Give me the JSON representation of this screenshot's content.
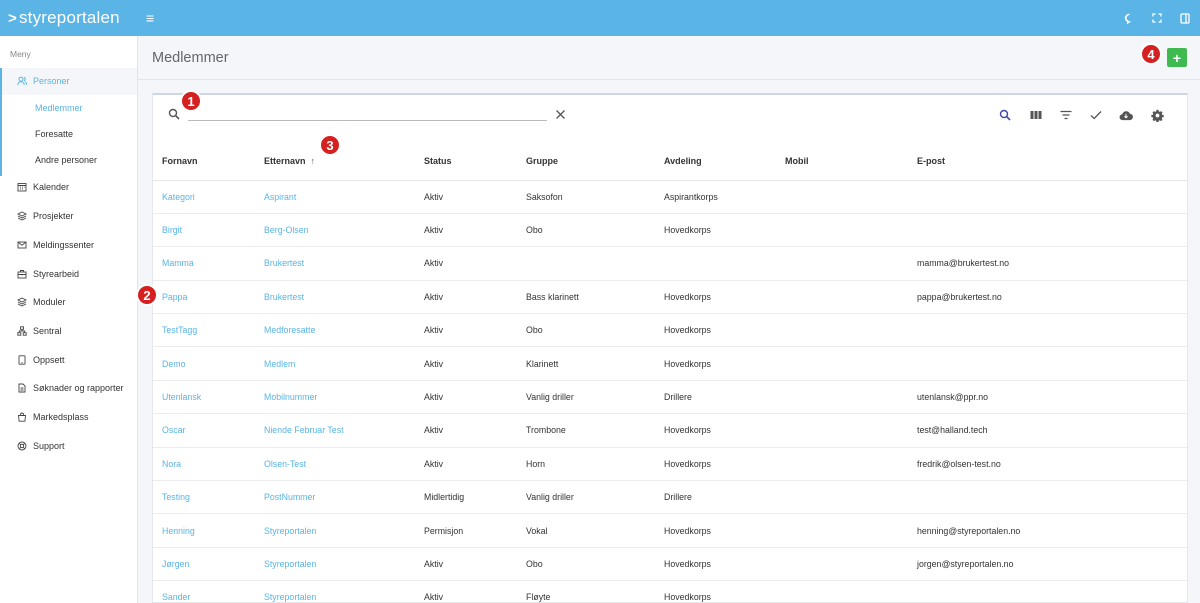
{
  "app": {
    "logo_mark": ">",
    "logo_text": "styreportalen"
  },
  "sidebar": {
    "menu_label": "Meny",
    "group": {
      "label": "Personer",
      "children": [
        {
          "label": "Medlemmer",
          "active": true
        },
        {
          "label": "Foresatte",
          "active": false
        },
        {
          "label": "Andre personer",
          "active": false
        }
      ]
    },
    "items": [
      {
        "label": "Kalender",
        "icon": "calendar-icon"
      },
      {
        "label": "Prosjekter",
        "icon": "layers-icon"
      },
      {
        "label": "Meldingssenter",
        "icon": "mail-icon"
      },
      {
        "label": "Styrearbeid",
        "icon": "briefcase-icon"
      },
      {
        "label": "Moduler",
        "icon": "layers-icon"
      },
      {
        "label": "Sentral",
        "icon": "sitemap-icon"
      },
      {
        "label": "Oppsett",
        "icon": "tablet-icon"
      },
      {
        "label": "Søknader og rapporter",
        "icon": "document-icon"
      },
      {
        "label": "Markedsplass",
        "icon": "shopping-bag-icon"
      },
      {
        "label": "Support",
        "icon": "lifebuoy-icon"
      }
    ]
  },
  "page": {
    "title": "Medlemmer",
    "add_label": "+"
  },
  "badges": [
    "1",
    "2",
    "3",
    "4"
  ],
  "search": {
    "value": "",
    "placeholder": ""
  },
  "table": {
    "columns": [
      "Fornavn",
      "Etternavn",
      "Status",
      "Gruppe",
      "Avdeling",
      "Mobil",
      "E-post"
    ],
    "sort_column": "Etternavn",
    "sort_arrow": "↑",
    "rows": [
      {
        "fornavn": "Kategori",
        "etternavn": "Aspirant",
        "status": "Aktiv",
        "gruppe": "Saksofon",
        "avdeling": "Aspirantkorps",
        "mobil": "",
        "epost": ""
      },
      {
        "fornavn": "Birgit",
        "etternavn": "Berg-Olsen",
        "status": "Aktiv",
        "gruppe": "Obo",
        "avdeling": "Hovedkorps",
        "mobil": "",
        "epost": ""
      },
      {
        "fornavn": "Mamma",
        "etternavn": "Brukertest",
        "status": "Aktiv",
        "gruppe": "",
        "avdeling": "",
        "mobil": "",
        "epost": "mamma@brukertest.no"
      },
      {
        "fornavn": "Pappa",
        "etternavn": "Brukertest",
        "status": "Aktiv",
        "gruppe": "Bass klarinett",
        "avdeling": "Hovedkorps",
        "mobil": "",
        "epost": "pappa@brukertest.no"
      },
      {
        "fornavn": "TestTagg",
        "etternavn": "Medforesatte",
        "status": "Aktiv",
        "gruppe": "Obo",
        "avdeling": "Hovedkorps",
        "mobil": "",
        "epost": ""
      },
      {
        "fornavn": "Demo",
        "etternavn": "Medlem",
        "status": "Aktiv",
        "gruppe": "Klarinett",
        "avdeling": "Hovedkorps",
        "mobil": "",
        "epost": ""
      },
      {
        "fornavn": "Utenlansk",
        "etternavn": "Mobilnummer",
        "status": "Aktiv",
        "gruppe": "Vanlig driller",
        "avdeling": "Drillere",
        "mobil": "",
        "epost": "utenlansk@ppr.no"
      },
      {
        "fornavn": "Oscar",
        "etternavn": "Niende Februar Test",
        "status": "Aktiv",
        "gruppe": "Trombone",
        "avdeling": "Hovedkorps",
        "mobil": "",
        "epost": "test@halland.tech"
      },
      {
        "fornavn": "Nora",
        "etternavn": "Olsen-Test",
        "status": "Aktiv",
        "gruppe": "Horn",
        "avdeling": "Hovedkorps",
        "mobil": "",
        "epost": "fredrik@olsen-test.no"
      },
      {
        "fornavn": "Testing",
        "etternavn": "PostNummer",
        "status": "Midlertidig",
        "gruppe": "Vanlig driller",
        "avdeling": "Drillere",
        "mobil": "",
        "epost": ""
      },
      {
        "fornavn": "Henning",
        "etternavn": "Styreportalen",
        "status": "Permisjon",
        "gruppe": "Vokal",
        "avdeling": "Hovedkorps",
        "mobil": "",
        "epost": "henning@styreportalen.no"
      },
      {
        "fornavn": "Jørgen",
        "etternavn": "Styreportalen",
        "status": "Aktiv",
        "gruppe": "Obo",
        "avdeling": "Hovedkorps",
        "mobil": "",
        "epost": "jorgen@styreportalen.no"
      },
      {
        "fornavn": "Sander",
        "etternavn": "Styreportalen",
        "status": "Aktiv",
        "gruppe": "Fløyte",
        "avdeling": "Hovedkorps",
        "mobil": "",
        "epost": ""
      }
    ]
  },
  "colors": {
    "topbar": "#5ab4e5",
    "link": "#5ab4e5",
    "add_button": "#3fba50",
    "badge": "#d42020"
  }
}
